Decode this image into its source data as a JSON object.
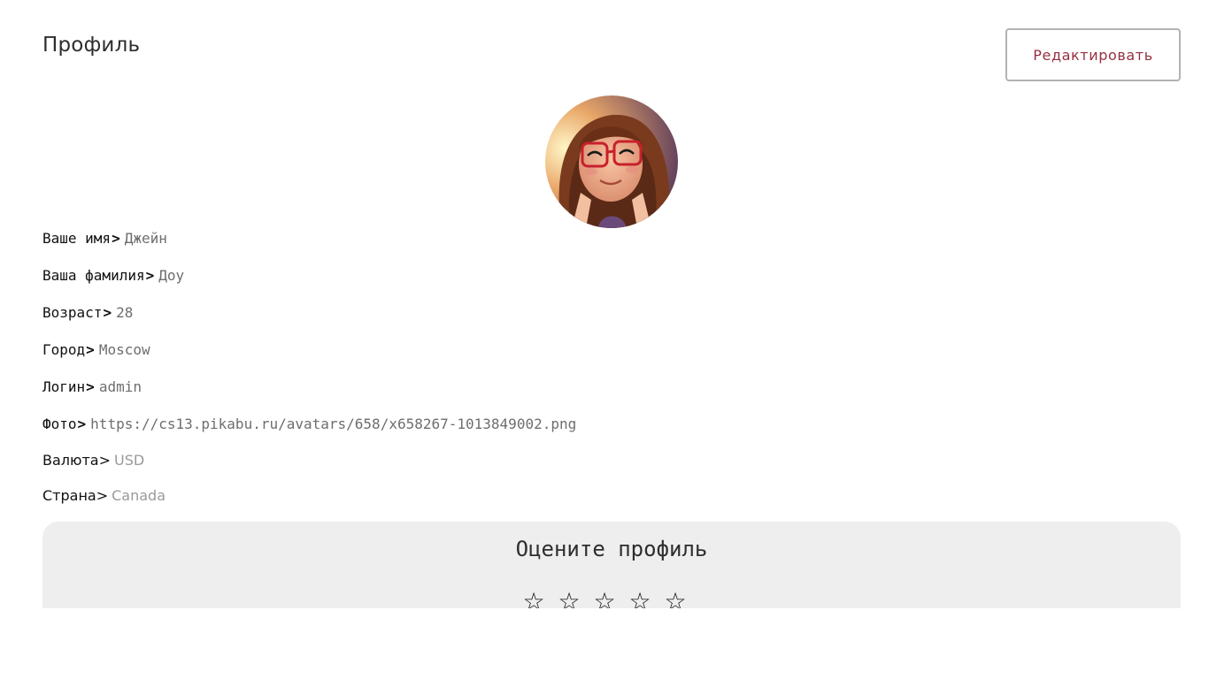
{
  "header": {
    "title": "Профиль",
    "edit_label": "Редактировать"
  },
  "profile": {
    "fields": [
      {
        "label": "Ваше имя",
        "separator": ">",
        "value": "Джейн"
      },
      {
        "label": "Ваша фамилия",
        "separator": ">",
        "value": "Доу"
      },
      {
        "label": "Возраст",
        "separator": ">",
        "value": "28"
      },
      {
        "label": "Город",
        "separator": ">",
        "value": "Moscow"
      },
      {
        "label": "Логин",
        "separator": ">",
        "value": "admin"
      },
      {
        "label": "Фото",
        "separator": ">",
        "value": "https://cs13.pikabu.ru/avatars/658/x658267-1013849002.png"
      },
      {
        "label": "Валюта",
        "separator": ">",
        "value": "USD"
      },
      {
        "label": "Страна",
        "separator": ">",
        "value": "Canada"
      }
    ]
  },
  "rating": {
    "title": "Оцените профиль",
    "max_stars": 5,
    "selected": 0,
    "star_glyph": "☆"
  },
  "colors": {
    "accent": "#96303f",
    "panel_bg": "#eeeeee",
    "value_text": "#6e6e6e"
  }
}
